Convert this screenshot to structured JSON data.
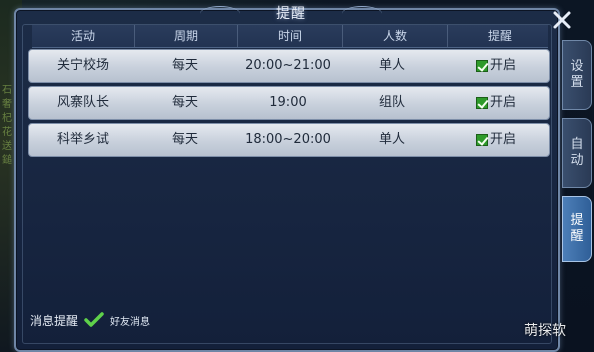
{
  "window": {
    "title": "提醒",
    "close_icon": "close-icon"
  },
  "background": {
    "left_text": "石奢杞花送鎚"
  },
  "table": {
    "columns": [
      "活动",
      "周期",
      "时间",
      "人数",
      "提醒"
    ],
    "rows": [
      {
        "activity": "关宁校场",
        "cycle": "每天",
        "time": "20:00~21:00",
        "people": "单人",
        "remind": "开启"
      },
      {
        "activity": "风寨队长",
        "cycle": "每天",
        "time": "19:00",
        "people": "组队",
        "remind": "开启"
      },
      {
        "activity": "科举乡试",
        "cycle": "每天",
        "time": "18:00~20:00",
        "people": "单人",
        "remind": "开启"
      }
    ]
  },
  "footer": {
    "label": "消息提醒",
    "option": "好友消息",
    "checked": true
  },
  "side_tabs": [
    {
      "label": "设置",
      "chars": [
        "设",
        "置"
      ],
      "active": false
    },
    {
      "label": "自动",
      "chars": [
        "自",
        "动"
      ],
      "active": false
    },
    {
      "label": "提醒",
      "chars": [
        "提",
        "醒"
      ],
      "active": true
    }
  ],
  "watermark": "萌探软",
  "colors": {
    "accent_active_tab": "#4d7fb8",
    "checkbox_green": "#2e9a2a",
    "panel_bg": "#1c2c47",
    "row_bg": "#d4dae3"
  }
}
